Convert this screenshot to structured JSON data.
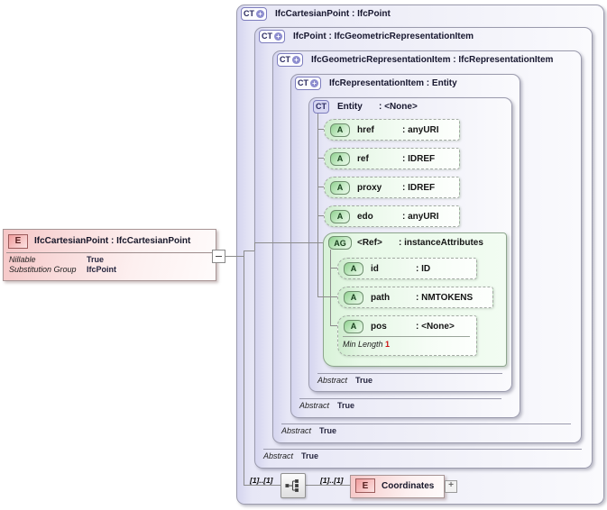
{
  "element": {
    "icon": "E",
    "title": "IfcCartesianPoint : IfcCartesianPoint",
    "properties": [
      {
        "label": "Nillable",
        "value": "True"
      },
      {
        "label": "Substitution Group",
        "value": "IfcPoint"
      }
    ]
  },
  "types": [
    {
      "icon": "CT",
      "plus": "+",
      "title": "IfcCartesianPoint : IfcPoint"
    },
    {
      "icon": "CT",
      "plus": "+",
      "title": "IfcPoint : IfcGeometricRepresentationItem",
      "abstract_label": "Abstract",
      "abstract_value": "True"
    },
    {
      "icon": "CT",
      "plus": "+",
      "title": "IfcGeometricRepresentationItem : IfcRepresentationItem",
      "abstract_label": "Abstract",
      "abstract_value": "True"
    },
    {
      "icon": "CT",
      "plus": "+",
      "title": "IfcRepresentationItem : Entity",
      "abstract_label": "Abstract",
      "abstract_value": "True"
    },
    {
      "icon": "CT",
      "name": "Entity",
      "type": ": <None>",
      "abstract_label": "Abstract",
      "abstract_value": "True"
    }
  ],
  "entity_attributes": [
    {
      "icon": "A",
      "name": "href",
      "type": ": anyURI"
    },
    {
      "icon": "A",
      "name": "ref",
      "type": ": IDREF"
    },
    {
      "icon": "A",
      "name": "proxy",
      "type": ": IDREF"
    },
    {
      "icon": "A",
      "name": "edo",
      "type": ": anyURI"
    }
  ],
  "attribute_group": {
    "icon": "AG",
    "name": "<Ref>",
    "type": ": instanceAttributes",
    "attributes": [
      {
        "icon": "A",
        "name": "id",
        "type": ": ID"
      },
      {
        "icon": "A",
        "name": "path",
        "type": ": NMTOKENS"
      },
      {
        "icon": "A",
        "name": "pos",
        "type": ": <None>",
        "facet_label": "Min Length",
        "facet_value": "1"
      }
    ]
  },
  "content": {
    "cardinality_left": "[1]..[1]",
    "cardinality_right": "[1]..[1]",
    "child": {
      "icon": "E",
      "title": "Coordinates",
      "expand": "+"
    }
  }
}
